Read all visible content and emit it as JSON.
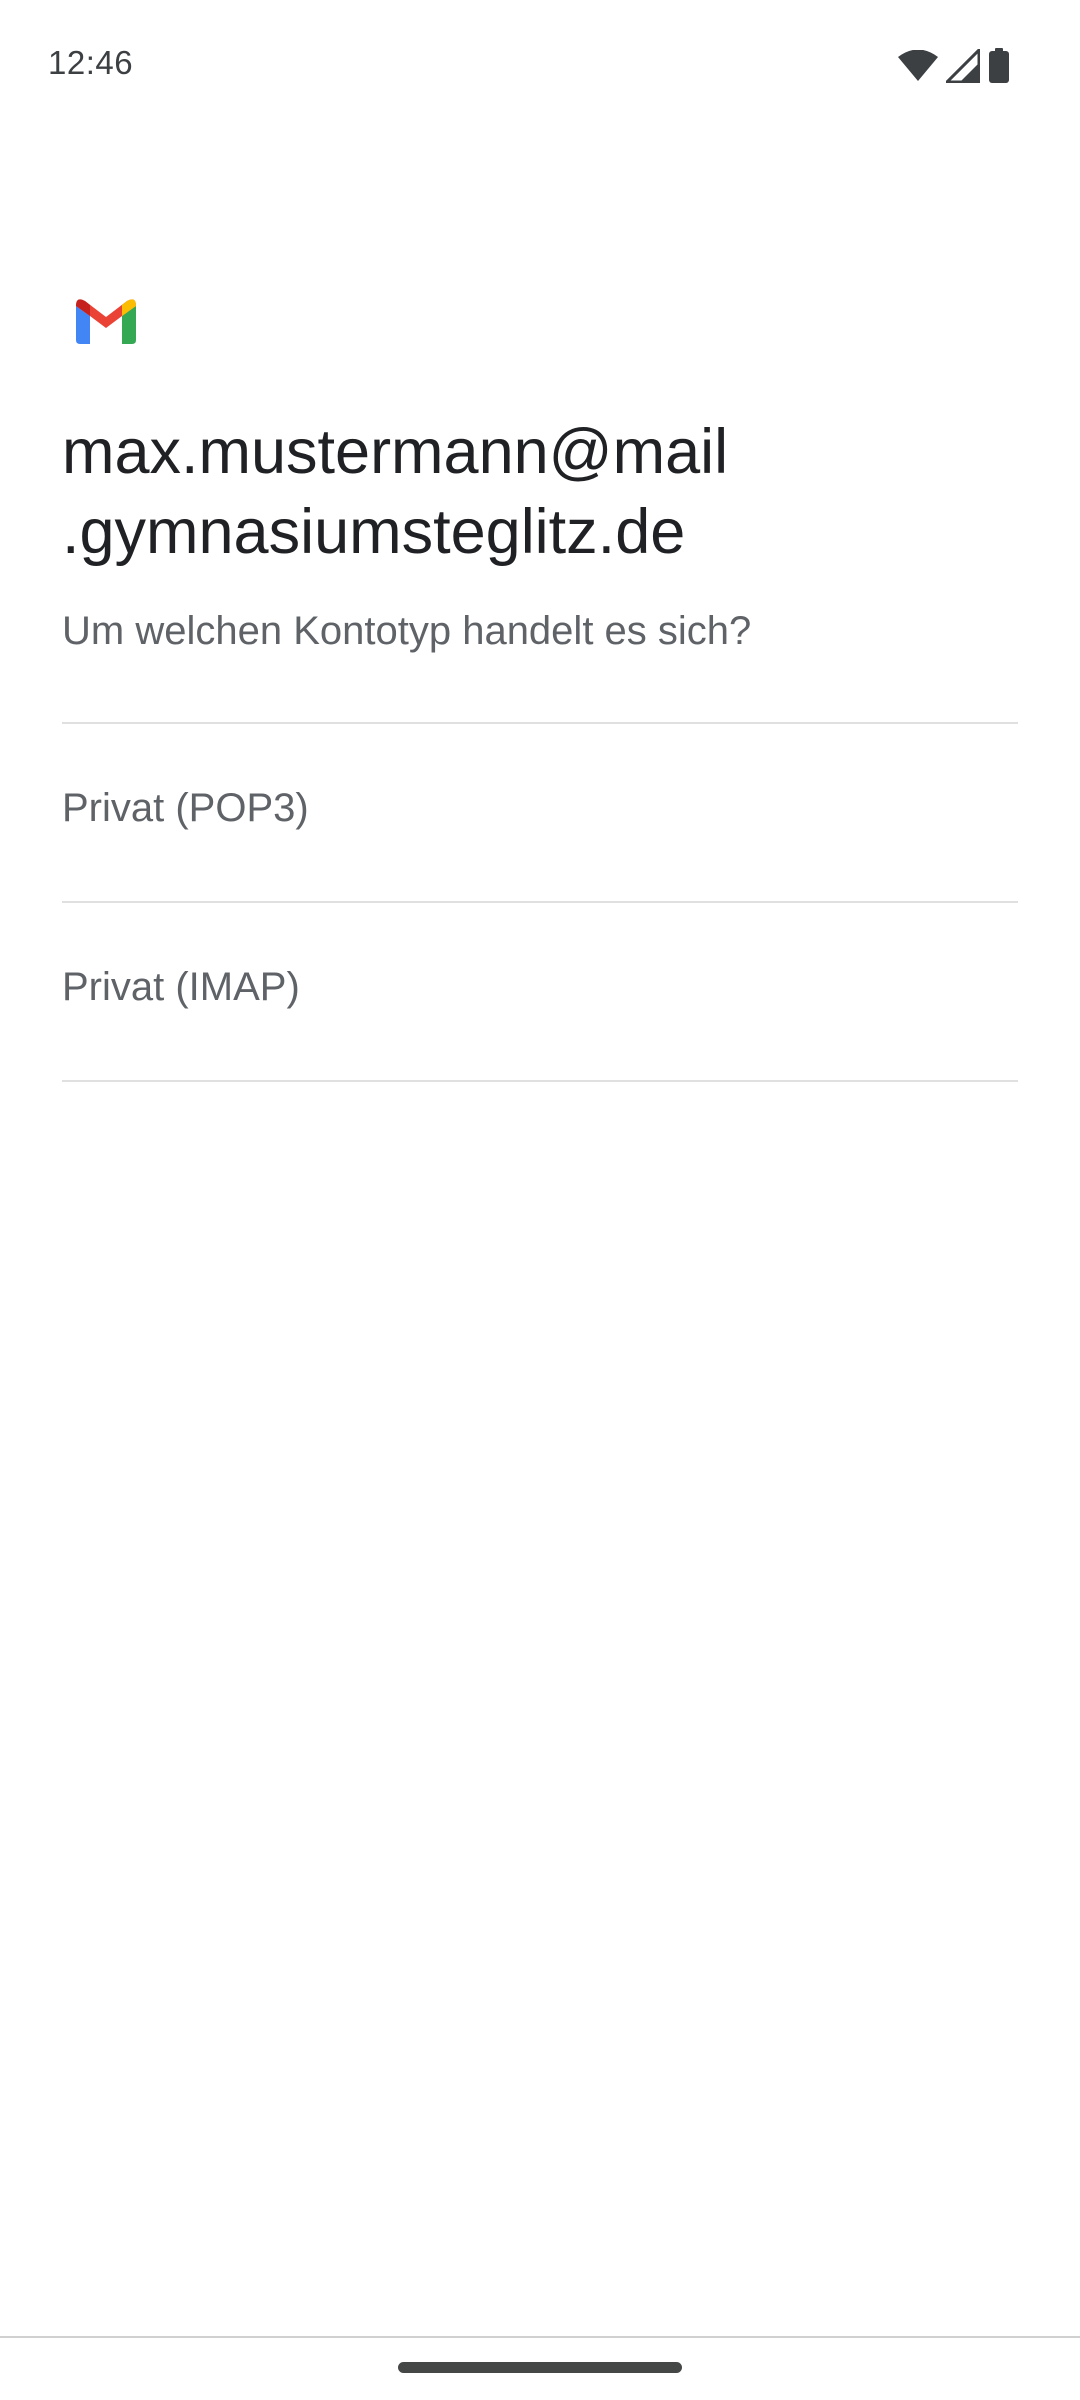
{
  "status_bar": {
    "time": "12:46",
    "icons": [
      "wifi-icon",
      "cellular-signal-icon",
      "battery-icon"
    ]
  },
  "logo": {
    "name": "gmail-logo",
    "colors": {
      "red": "#EA4335",
      "blue": "#4285F4",
      "green": "#34A853",
      "yellow": "#FBBC04"
    }
  },
  "header": {
    "email_line1": "max.mustermann@mail",
    "email_line2": ".gymnasiumsteglitz.de",
    "question": "Um welchen Kontotyp handelt es sich?"
  },
  "options": [
    {
      "label": "Privat (POP3)"
    },
    {
      "label": "Privat (IMAP)"
    }
  ],
  "colors": {
    "heading_text": "#202124",
    "secondary_text": "#5f6368",
    "divider": "#e0e0e0",
    "background": "#ffffff"
  }
}
